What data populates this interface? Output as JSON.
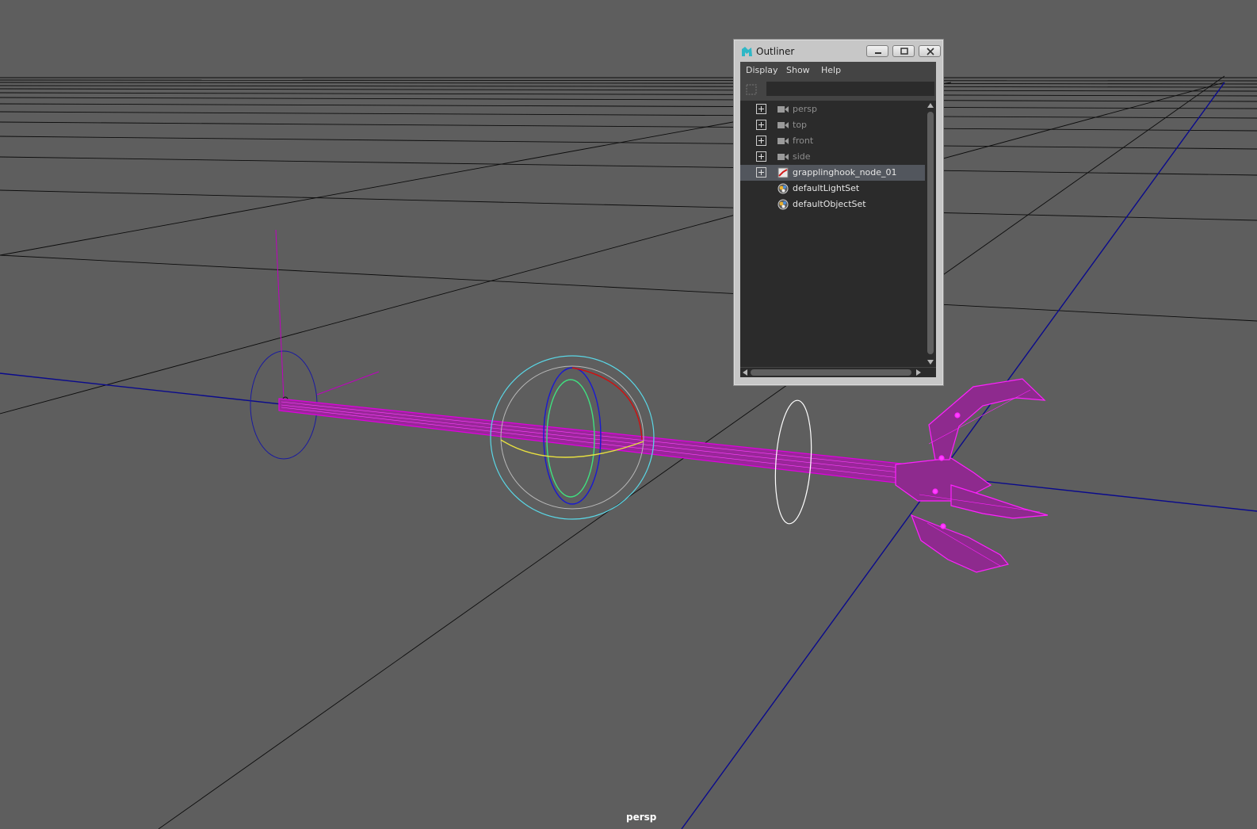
{
  "viewport": {
    "camera_label": "persp",
    "background_color": "#5e5e5e",
    "grid_color": "#000000",
    "axis_color": "#0a0a8c",
    "selection_color": "#e000e0"
  },
  "outliner": {
    "title": "Outliner",
    "title_icon": "maya-logo-icon",
    "window_buttons": [
      "minimize-icon",
      "restore-icon",
      "close-icon"
    ],
    "menu": [
      "Display",
      "Show",
      "Help"
    ],
    "filter": {
      "value": "",
      "placeholder": ""
    },
    "items": [
      {
        "label": "persp",
        "icon": "camera-icon",
        "expandable": true,
        "dim": true,
        "selected": false
      },
      {
        "label": "top",
        "icon": "camera-icon",
        "expandable": true,
        "dim": true,
        "selected": false
      },
      {
        "label": "front",
        "icon": "camera-icon",
        "expandable": true,
        "dim": true,
        "selected": false
      },
      {
        "label": "side",
        "icon": "camera-icon",
        "expandable": true,
        "dim": true,
        "selected": false
      },
      {
        "label": "grapplinghook_node_01",
        "icon": "group-node-icon",
        "expandable": true,
        "dim": false,
        "selected": true
      },
      {
        "label": "defaultLightSet",
        "icon": "set-icon",
        "expandable": false,
        "dim": false,
        "selected": false
      },
      {
        "label": "defaultObjectSet",
        "icon": "set-icon",
        "expandable": false,
        "dim": false,
        "selected": false
      }
    ]
  }
}
